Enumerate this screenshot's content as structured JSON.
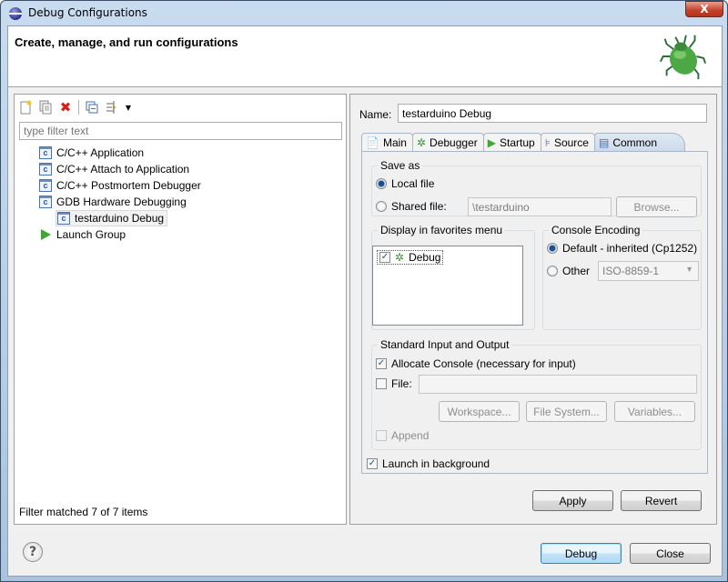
{
  "window": {
    "title": "Debug Configurations",
    "close_label": "X"
  },
  "header": {
    "title": "Create, manage, and run configurations"
  },
  "toolbar": {
    "icons": [
      "new-config-icon",
      "duplicate-icon",
      "delete-icon",
      "collapse-all-icon",
      "filter-icon",
      "dropdown-arrow-icon"
    ]
  },
  "filter": {
    "placeholder": "type filter text",
    "status": "Filter matched 7 of 7 items"
  },
  "tree": {
    "items": [
      {
        "label": "C/C++ Application",
        "icon": "c-icon"
      },
      {
        "label": "C/C++ Attach to Application",
        "icon": "c-icon"
      },
      {
        "label": "C/C++ Postmortem Debugger",
        "icon": "c-icon"
      },
      {
        "label": "GDB Hardware Debugging",
        "icon": "c-icon"
      },
      {
        "label": "testarduino Debug",
        "icon": "c-icon",
        "selected": true
      },
      {
        "label": "Launch Group",
        "icon": "launch-icon"
      }
    ]
  },
  "config": {
    "name_label": "Name:",
    "name_value": "testarduino Debug",
    "tabs": [
      {
        "label": "Main",
        "icon": "document-icon"
      },
      {
        "label": "Debugger",
        "icon": "bug-icon"
      },
      {
        "label": "Startup",
        "icon": "play-icon"
      },
      {
        "label": "Source",
        "icon": "source-icon"
      },
      {
        "label": "Common",
        "icon": "table-icon",
        "active": true
      }
    ],
    "save_as": {
      "title": "Save as",
      "local_label": "Local file",
      "shared_label": "Shared file:",
      "shared_value": "\\testarduino",
      "browse_label": "Browse...",
      "selected": "local"
    },
    "favorites": {
      "title": "Display in favorites menu",
      "items": [
        {
          "label": "Debug",
          "checked": true
        }
      ]
    },
    "encoding": {
      "title": "Console Encoding",
      "default_label": "Default - inherited (Cp1252)",
      "other_label": "Other",
      "other_value": "ISO-8859-1",
      "selected": "default"
    },
    "stdio": {
      "title": "Standard Input and Output",
      "allocate_label": "Allocate Console (necessary for input)",
      "allocate_checked": true,
      "file_label": "File:",
      "file_checked": false,
      "file_value": "",
      "workspace_label": "Workspace...",
      "filesystem_label": "File System...",
      "variables_label": "Variables...",
      "append_label": "Append",
      "append_checked": false
    },
    "background_label": "Launch in background",
    "background_checked": true,
    "apply_label": "Apply",
    "revert_label": "Revert"
  },
  "footer": {
    "debug_label": "Debug",
    "close_label": "Close",
    "help_label": "?"
  }
}
